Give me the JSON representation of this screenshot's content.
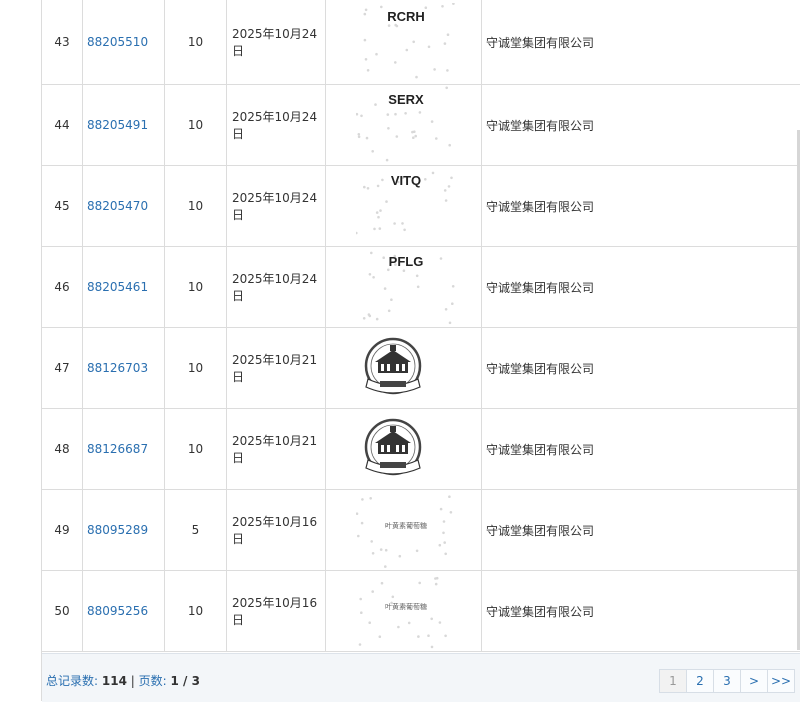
{
  "rows": [
    {
      "num": "43",
      "reg": "88205510",
      "cls": "10",
      "date": "2025年10月24日",
      "mark": "RCRH",
      "mark_kind": "text",
      "owner": "守诚堂集团有限公司"
    },
    {
      "num": "44",
      "reg": "88205491",
      "cls": "10",
      "date": "2025年10月24日",
      "mark": "SERX",
      "mark_kind": "text",
      "owner": "守诚堂集团有限公司"
    },
    {
      "num": "45",
      "reg": "88205470",
      "cls": "10",
      "date": "2025年10月24日",
      "mark": "VITQ",
      "mark_kind": "text",
      "owner": "守诚堂集团有限公司"
    },
    {
      "num": "46",
      "reg": "88205461",
      "cls": "10",
      "date": "2025年10月24日",
      "mark": "PFLG",
      "mark_kind": "text",
      "owner": "守诚堂集团有限公司"
    },
    {
      "num": "47",
      "reg": "88126703",
      "cls": "10",
      "date": "2025年10月21日",
      "mark": "",
      "mark_kind": "emblem",
      "owner": "守诚堂集团有限公司"
    },
    {
      "num": "48",
      "reg": "88126687",
      "cls": "10",
      "date": "2025年10月21日",
      "mark": "",
      "mark_kind": "emblem",
      "owner": "守诚堂集团有限公司"
    },
    {
      "num": "49",
      "reg": "88095289",
      "cls": "5",
      "date": "2025年10月16日",
      "mark": "叶黄素葡萄糖",
      "mark_kind": "small",
      "owner": "守诚堂集团有限公司"
    },
    {
      "num": "50",
      "reg": "88095256",
      "cls": "10",
      "date": "2025年10月16日",
      "mark": "叶黄素葡萄糖",
      "mark_kind": "small",
      "owner": "守诚堂集团有限公司"
    }
  ],
  "footer": {
    "total_label": "总记录数:",
    "total_value": "114",
    "separator": "|",
    "pages_label": "页数:",
    "pages_value": "1 / 3"
  },
  "pager": [
    "1",
    "2",
    "3",
    ">",
    ">>"
  ],
  "colors": {
    "link": "#2a6fb0",
    "border": "#dcdcdc",
    "footer_bg": "#f3f6f9"
  }
}
